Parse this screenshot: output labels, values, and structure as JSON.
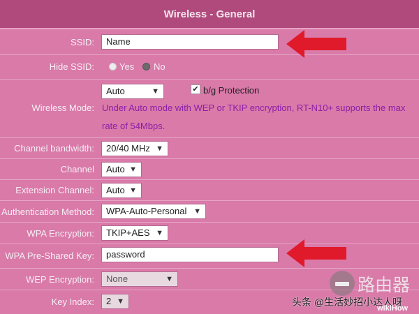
{
  "header": {
    "title": "Wireless - General"
  },
  "rows": {
    "ssid": {
      "label": "SSID:",
      "value": "Name"
    },
    "hide_ssid": {
      "label": "Hide SSID:",
      "yes": "Yes",
      "no": "No"
    },
    "wireless_mode": {
      "label": "Wireless Mode:",
      "selected": "Auto",
      "checkbox_label": "b/g Protection",
      "note_line1": "Under Auto mode with WEP or TKIP encryption, RT-N10+ supports the max",
      "note_line2": "rate of 54Mbps."
    },
    "channel_bandwidth": {
      "label": "Channel bandwidth:",
      "selected": "20/40 MHz"
    },
    "channel": {
      "label": "Channel",
      "selected": "Auto"
    },
    "extension_channel": {
      "label": "Extension Channel:",
      "selected": "Auto"
    },
    "auth_method": {
      "label": "Authentication Method:",
      "selected": "WPA-Auto-Personal"
    },
    "wpa_encryption": {
      "label": "WPA Encryption:",
      "selected": "TKIP+AES"
    },
    "wpa_key": {
      "label": "WPA Pre-Shared Key:",
      "value": "password"
    },
    "wep_encryption": {
      "label": "WEP Encryption:",
      "selected": "None"
    },
    "key_index": {
      "label": "Key Index:",
      "selected": "2"
    }
  },
  "watermark": {
    "toutiao": "头条 @生活妙招小达人呀",
    "router_brand": "路由器",
    "wikihow": "wikiHow"
  },
  "colors": {
    "background": "#d97aa9",
    "header": "#b04a7c",
    "arrow": "#e01a2a",
    "note_text": "#8a1fa6"
  },
  "icons": {
    "arrow": "red-arrow-left-icon",
    "check": "checkmark-icon",
    "caret": "caret-down-icon"
  }
}
